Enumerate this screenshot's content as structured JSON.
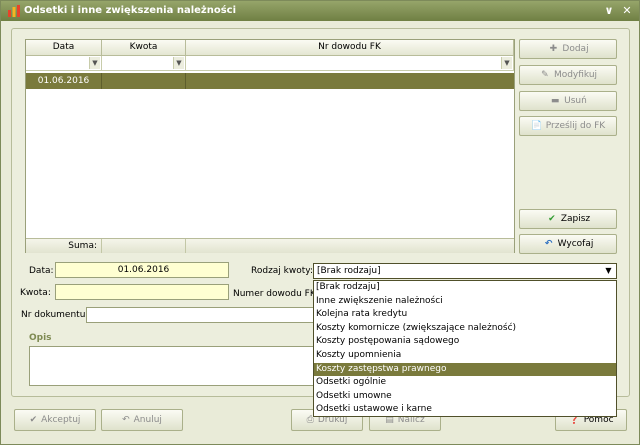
{
  "window": {
    "title": "Odsetki i inne zwiększenia należności"
  },
  "grid": {
    "columns": [
      "Data",
      "Kwota",
      "Nr dowodu FK"
    ],
    "rows": [
      {
        "data": "01.06.2016",
        "kwota": "",
        "nr_dowodu": ""
      }
    ],
    "sum_label": "Suma:"
  },
  "side_buttons": {
    "dodaj": "Dodaj",
    "modyfikuj": "Modyfikuj",
    "usun": "Usuń",
    "przeslij": "Prześlij do FK",
    "zapisz": "Zapisz",
    "wycofaj": "Wycofaj"
  },
  "form": {
    "data_label": "Data:",
    "data_value": "01.06.2016",
    "kwota_label": "Kwota:",
    "kwota_value": "",
    "rodzaj_label": "Rodzaj kwoty:",
    "rodzaj_value": "[Brak rodzaju]",
    "numer_fk_label": "Numer dowodu FK:",
    "nr_dok_label": "Nr dokumentu:",
    "nr_dok_value": "",
    "opis_label": "Opis"
  },
  "dropdown": {
    "options": [
      "[Brak rodzaju]",
      "Inne zwiększenie należności",
      "Kolejna rata kredytu",
      "Koszty komornicze (zwiększające należność)",
      "Koszty postępowania sądowego",
      "Koszty upomnienia",
      "Koszty zastępstwa prawnego",
      "Odsetki ogólnie",
      "Odsetki umowne",
      "Odsetki ustawowe i karne"
    ],
    "selected_index": 6
  },
  "bottom_buttons": {
    "akceptuj": "Akceptuj",
    "anuluj": "Anuluj",
    "drukuj": "Drukuj",
    "nalicz": "Nalicz",
    "pomoc": "Pomoc"
  },
  "colors": {
    "accent": "#7a7a3c",
    "title_bar": "#7d8d4f",
    "input_highlight": "#ffffd2"
  }
}
